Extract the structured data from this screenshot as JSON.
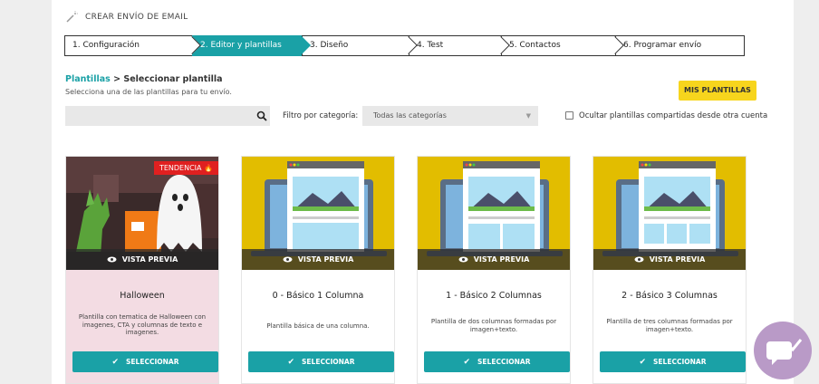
{
  "header": {
    "title": "CREAR ENVÍO DE EMAIL"
  },
  "steps": [
    {
      "label": "1. Configuración",
      "active": false
    },
    {
      "label": "2. Editor y plantillas",
      "active": true
    },
    {
      "label": "3. Diseño",
      "active": false
    },
    {
      "label": "4. Test",
      "active": false
    },
    {
      "label": "5. Contactos",
      "active": false
    },
    {
      "label": "6. Programar envío",
      "active": false
    }
  ],
  "breadcrumb": {
    "link": "Plantillas",
    "separator": " > ",
    "current": "Seleccionar plantilla"
  },
  "subtitle": "Selecciona una de las plantillas para tu envío.",
  "mis_plantillas": "MIS PLANTILLAS",
  "search": {
    "placeholder": ""
  },
  "filter": {
    "label": "Filtro por categoría:",
    "selected": "Todas las categorías"
  },
  "hide_shared": {
    "label": "Ocultar plantillas compartidas desde otra cuenta",
    "checked": false
  },
  "preview_label": "VISTA PREVIA",
  "select_label": "SELECCIONAR",
  "trend_label": "TENDENCIA",
  "cards": [
    {
      "title": "Halloween",
      "desc": "Plantilla con tematica de Halloween con imagenes, CTA y columnas de texto e imagenes."
    },
    {
      "title": "0 - Básico 1 Columna",
      "desc": "Plantilla básica de una columna."
    },
    {
      "title": "1 - Básico 2 Columnas",
      "desc": "Plantilla de dos columnas formadas por imagen+texto."
    },
    {
      "title": "2 - Básico 3 Columnas",
      "desc": "Plantilla de tres columnas formadas por imagen+texto."
    }
  ],
  "colors": {
    "teal": "#1aa1a6",
    "yellow": "#f7d51d",
    "trend_red": "#e02020",
    "chat": "#b99ac7"
  }
}
